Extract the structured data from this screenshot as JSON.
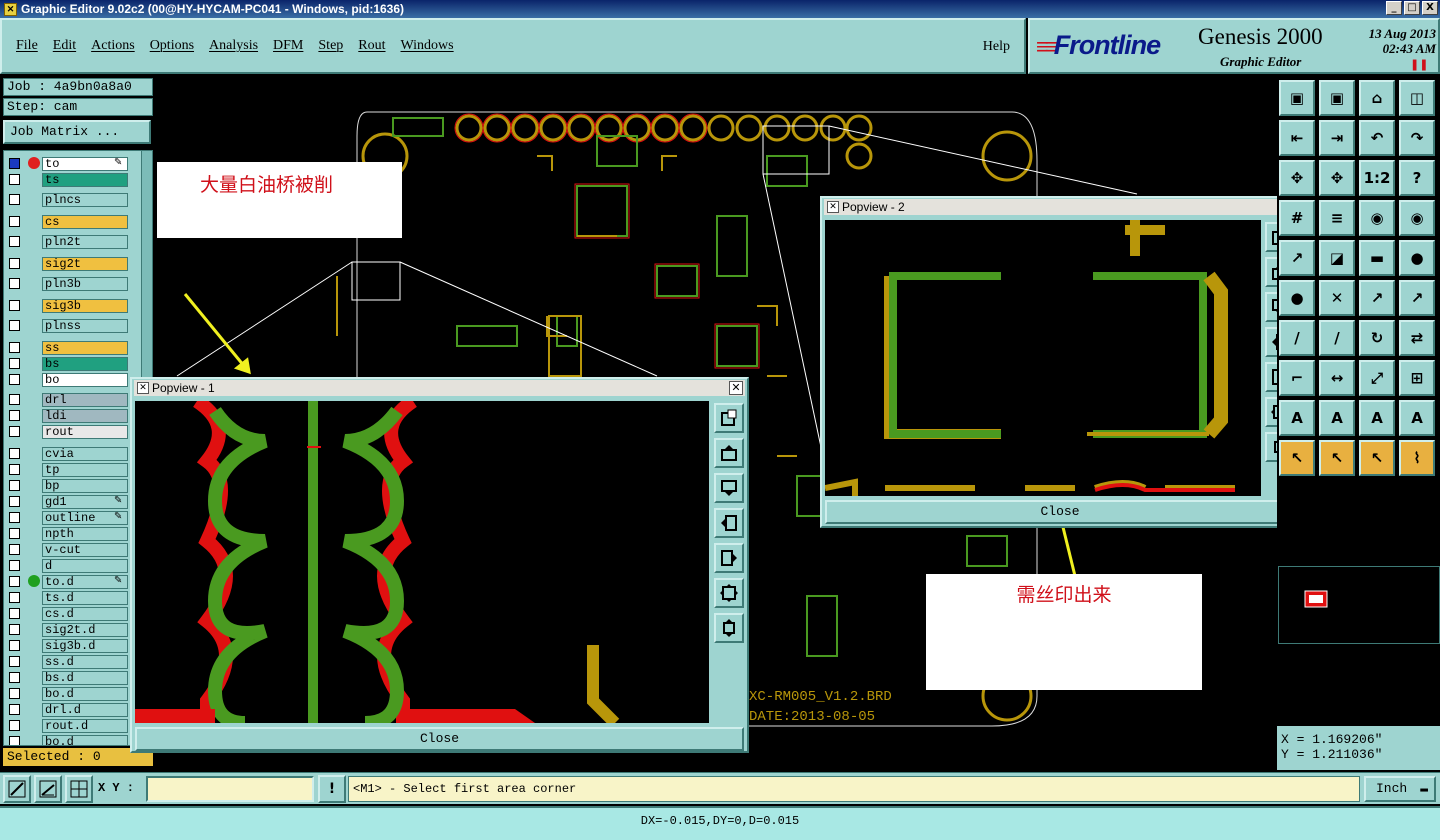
{
  "window": {
    "title": "Graphic Editor 9.02c2 (00@HY-HYCAM-PC041 - Windows, pid:1636)",
    "minimize": "_",
    "maximize": "□",
    "close": "X"
  },
  "menu": {
    "items": [
      "File",
      "Edit",
      "Actions",
      "Options",
      "Analysis",
      "DFM",
      "Step",
      "Rout",
      "Windows"
    ],
    "help": "Help"
  },
  "brand": {
    "logo": "Frontline",
    "product": "Genesis 2000",
    "subtitle": "Graphic Editor",
    "date": "13 Aug 2013",
    "time": "02:43 AM"
  },
  "job": {
    "job_line": "Job : 4a9bn0a8a0",
    "step_line": "Step: cam",
    "matrix_button": "Job Matrix ..."
  },
  "layers": [
    {
      "name": "to",
      "color": "#ffffff",
      "dot": "#e02020",
      "checked": true,
      "mark": "✎"
    },
    {
      "name": "ts",
      "color": "#20a080",
      "dot": "",
      "checked": false,
      "mark": ""
    },
    {
      "name": "plncs",
      "color": "#9ed4d0",
      "dot": "",
      "checked": false,
      "mark": ""
    },
    {
      "name": "cs",
      "color": "#f0c040",
      "dot": "",
      "checked": false,
      "mark": ""
    },
    {
      "name": "pln2t",
      "color": "#9ed4d0",
      "dot": "",
      "checked": false,
      "mark": ""
    },
    {
      "name": "sig2t",
      "color": "#f0c040",
      "dot": "",
      "checked": false,
      "mark": ""
    },
    {
      "name": "pln3b",
      "color": "#9ed4d0",
      "dot": "",
      "checked": false,
      "mark": ""
    },
    {
      "name": "sig3b",
      "color": "#f0c040",
      "dot": "",
      "checked": false,
      "mark": ""
    },
    {
      "name": "plnss",
      "color": "#9ed4d0",
      "dot": "",
      "checked": false,
      "mark": ""
    },
    {
      "name": "ss",
      "color": "#f0c040",
      "dot": "",
      "checked": false,
      "mark": ""
    },
    {
      "name": "bs",
      "color": "#20a080",
      "dot": "",
      "checked": false,
      "mark": ""
    },
    {
      "name": "bo",
      "color": "#ffffff",
      "dot": "",
      "checked": false,
      "mark": ""
    },
    {
      "name": "drl",
      "color": "#a0b8c0",
      "dot": "",
      "checked": false,
      "mark": ""
    },
    {
      "name": "ldi",
      "color": "#a0b8c0",
      "dot": "",
      "checked": false,
      "mark": ""
    },
    {
      "name": "rout",
      "color": "#e8e8e8",
      "dot": "",
      "checked": false,
      "mark": ""
    },
    {
      "name": "cvia",
      "color": "#9ed4d0",
      "dot": "",
      "checked": false,
      "mark": ""
    },
    {
      "name": "tp",
      "color": "#9ed4d0",
      "dot": "",
      "checked": false,
      "mark": ""
    },
    {
      "name": "bp",
      "color": "#9ed4d0",
      "dot": "",
      "checked": false,
      "mark": ""
    },
    {
      "name": "gd1",
      "color": "#9ed4d0",
      "dot": "",
      "checked": false,
      "mark": "✎"
    },
    {
      "name": "outline",
      "color": "#9ed4d0",
      "dot": "",
      "checked": false,
      "mark": "✎"
    },
    {
      "name": "npth",
      "color": "#9ed4d0",
      "dot": "",
      "checked": false,
      "mark": ""
    },
    {
      "name": "v-cut",
      "color": "#9ed4d0",
      "dot": "",
      "checked": false,
      "mark": ""
    },
    {
      "name": "d",
      "color": "#9ed4d0",
      "dot": "",
      "checked": false,
      "mark": ""
    },
    {
      "name": "to.d",
      "color": "#9ed4d0",
      "dot": "#20a020",
      "checked": false,
      "mark": "✎"
    },
    {
      "name": "ts.d",
      "color": "#9ed4d0",
      "dot": "",
      "checked": false,
      "mark": ""
    },
    {
      "name": "cs.d",
      "color": "#9ed4d0",
      "dot": "",
      "checked": false,
      "mark": ""
    },
    {
      "name": "sig2t.d",
      "color": "#9ed4d0",
      "dot": "",
      "checked": false,
      "mark": ""
    },
    {
      "name": "sig3b.d",
      "color": "#9ed4d0",
      "dot": "",
      "checked": false,
      "mark": ""
    },
    {
      "name": "ss.d",
      "color": "#9ed4d0",
      "dot": "",
      "checked": false,
      "mark": ""
    },
    {
      "name": "bs.d",
      "color": "#9ed4d0",
      "dot": "",
      "checked": false,
      "mark": ""
    },
    {
      "name": "bo.d",
      "color": "#9ed4d0",
      "dot": "",
      "checked": false,
      "mark": ""
    },
    {
      "name": "drl.d",
      "color": "#9ed4d0",
      "dot": "",
      "checked": false,
      "mark": ""
    },
    {
      "name": "rout.d",
      "color": "#9ed4d0",
      "dot": "",
      "checked": false,
      "mark": ""
    },
    {
      "name": "bo.d",
      "color": "#9ed4d0",
      "dot": "",
      "checked": false,
      "mark": ""
    }
  ],
  "selected": "Selected : 0",
  "annotations": {
    "left": "大量白油桥被削",
    "right": "需丝印出来"
  },
  "board_text": {
    "line1": "XC-RM005_V1.2.BRD",
    "line2": "DATE:2013-08-05"
  },
  "popview1": {
    "title": "Popview - 1",
    "close": "Close"
  },
  "popview2": {
    "title": "Popview - 2",
    "close": "Close"
  },
  "coords": {
    "x": "X = 1.169206\"",
    "y": "Y = 1.211036\""
  },
  "bottom": {
    "xy_label": "X Y :",
    "xy_value": "",
    "prompt": "<M1> - Select first area corner",
    "unit": "Inch"
  },
  "status": "DX=-0.015,DY=0,D=0.015",
  "colors": {
    "panel": "#9ed4d0",
    "copper_green": "#4a9a20",
    "silk_red": "#e01010",
    "mask_yellow": "#b8960a"
  }
}
